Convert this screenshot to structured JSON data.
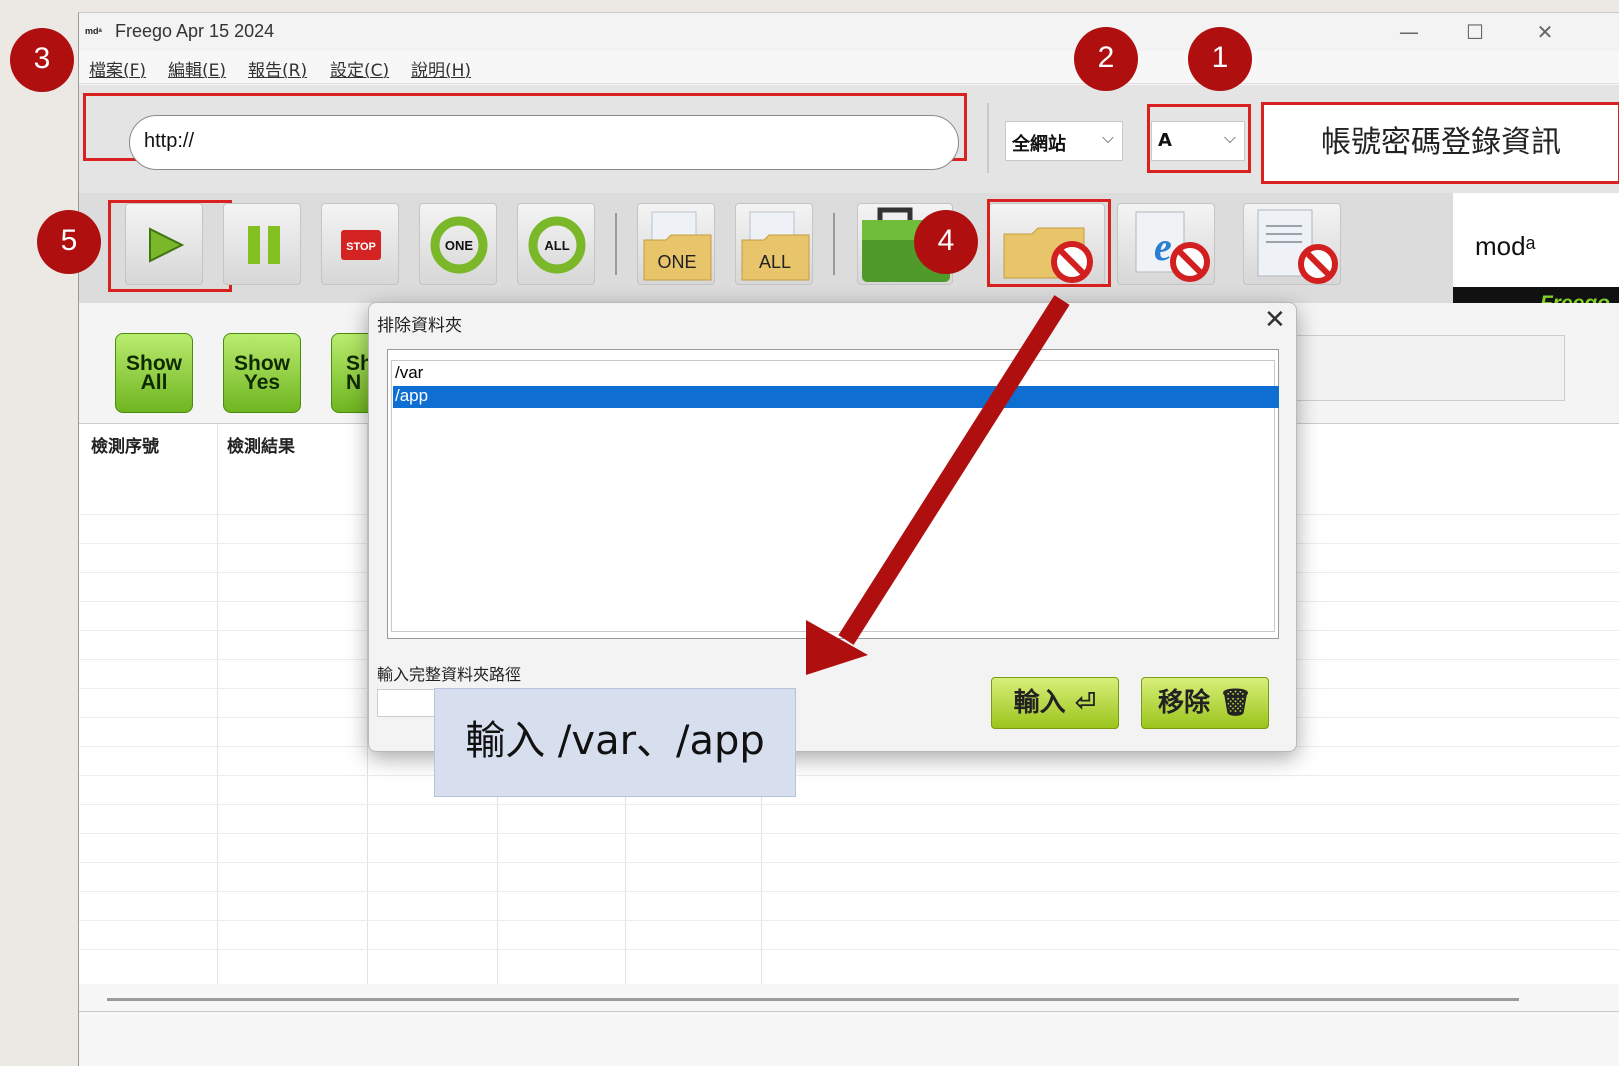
{
  "window": {
    "title": "Freego Apr 15 2024",
    "controls": {
      "minimize": "—",
      "maximize": "☐",
      "close": "✕"
    }
  },
  "menu": [
    "檔案(F)",
    "編輯(E)",
    "報告(R)",
    "設定(C)",
    "說明(H)"
  ],
  "url_bar": {
    "value": "http://"
  },
  "scope_select": {
    "selected": "全網站"
  },
  "grade_select": {
    "selected": "A"
  },
  "login_info_label": "帳號密碼登錄資訊",
  "toolbar": {
    "stop_label": "STOP",
    "refresh_one_label": "ONE",
    "refresh_all_label": "ALL",
    "folder_one_label": "ONE",
    "folder_all_label": "ALL"
  },
  "logo": {
    "name": "Freego",
    "mark": "modᵃ"
  },
  "filters": [
    {
      "line1": "Show",
      "line2": "All"
    },
    {
      "line1": "Show",
      "line2": "Yes"
    },
    {
      "line1": "Sh",
      "line2": "N"
    }
  ],
  "table": {
    "columns": [
      "檢測序號",
      "檢測結果"
    ]
  },
  "dialog": {
    "title": "排除資料夾",
    "close": "✕",
    "items": [
      "/var",
      "/app"
    ],
    "selected_index": 1,
    "path_label": "輸入完整資料夾路徑",
    "input_button": "輸入 ⏎",
    "remove_button": "移除 🗑"
  },
  "callout_text": "輸入 /var、/app",
  "badges": [
    "1",
    "2",
    "3",
    "4",
    "5"
  ],
  "colors": {
    "badge": "#b00f0f",
    "highlight": "#d9211f",
    "selection": "#0f6ed2",
    "button_green": "#9bc41c"
  },
  "icons": [
    "play-icon",
    "pause-icon",
    "stop-icon",
    "refresh-one-icon",
    "refresh-all-icon",
    "folder-one-icon",
    "folder-all-icon",
    "toolbox-icon",
    "exclude-folder-icon",
    "exclude-browser-icon",
    "exclude-document-icon"
  ]
}
